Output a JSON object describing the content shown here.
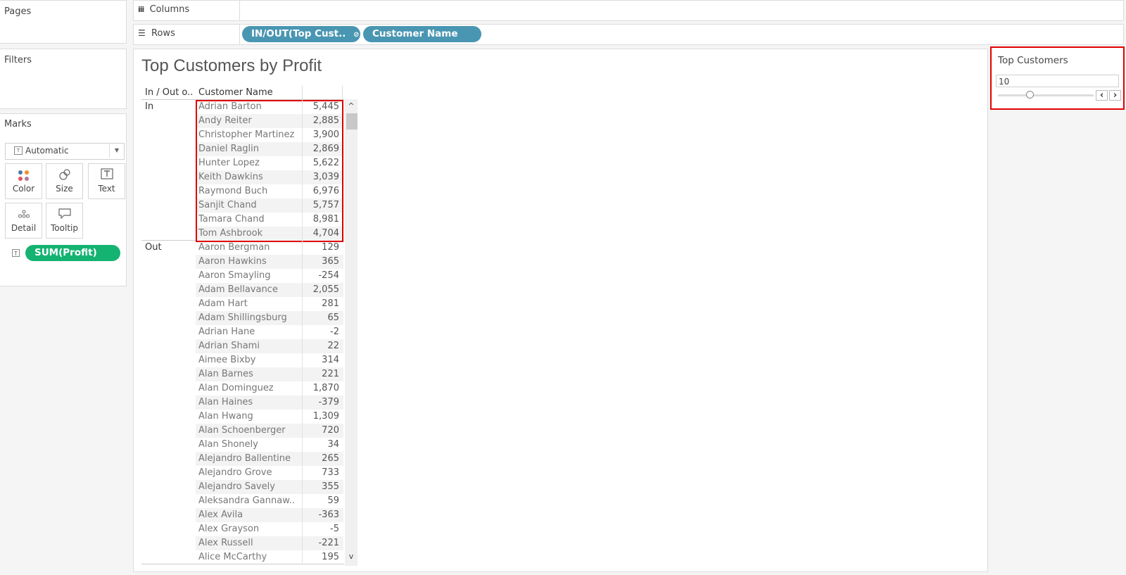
{
  "panes": {
    "pages": "Pages",
    "filters": "Filters",
    "marks": "Marks"
  },
  "marks": {
    "type_selected": "Automatic",
    "buttons": [
      {
        "label": "Color",
        "icon": "color-dots-icon"
      },
      {
        "label": "Size",
        "icon": "size-icon"
      },
      {
        "label": "Text",
        "icon": "text-icon"
      },
      {
        "label": "Detail",
        "icon": "detail-icon"
      },
      {
        "label": "Tooltip",
        "icon": "tooltip-icon"
      }
    ],
    "pill": "SUM(Profit)"
  },
  "shelves": {
    "columns_label": "Columns",
    "rows_label": "Rows",
    "rows_pills": [
      "IN/OUT(Top Cust..",
      "Customer Name"
    ]
  },
  "view": {
    "title": "Top Customers by Profit",
    "col_in_out": "In / Out o..",
    "col_customer": "Customer Name",
    "group_in": "In",
    "group_out": "Out",
    "in_rows": [
      {
        "name": "Adrian Barton",
        "value": "5,445"
      },
      {
        "name": "Andy Reiter",
        "value": "2,885"
      },
      {
        "name": "Christopher Martinez",
        "value": "3,900"
      },
      {
        "name": "Daniel Raglin",
        "value": "2,869"
      },
      {
        "name": "Hunter Lopez",
        "value": "5,622"
      },
      {
        "name": "Keith Dawkins",
        "value": "3,039"
      },
      {
        "name": "Raymond Buch",
        "value": "6,976"
      },
      {
        "name": "Sanjit Chand",
        "value": "5,757"
      },
      {
        "name": "Tamara Chand",
        "value": "8,981"
      },
      {
        "name": "Tom Ashbrook",
        "value": "4,704"
      }
    ],
    "out_rows": [
      {
        "name": "Aaron Bergman",
        "value": "129"
      },
      {
        "name": "Aaron Hawkins",
        "value": "365"
      },
      {
        "name": "Aaron Smayling",
        "value": "-254"
      },
      {
        "name": "Adam Bellavance",
        "value": "2,055"
      },
      {
        "name": "Adam Hart",
        "value": "281"
      },
      {
        "name": "Adam Shillingsburg",
        "value": "65"
      },
      {
        "name": "Adrian Hane",
        "value": "-2"
      },
      {
        "name": "Adrian Shami",
        "value": "22"
      },
      {
        "name": "Aimee Bixby",
        "value": "314"
      },
      {
        "name": "Alan Barnes",
        "value": "221"
      },
      {
        "name": "Alan Dominguez",
        "value": "1,870"
      },
      {
        "name": "Alan Haines",
        "value": "-379"
      },
      {
        "name": "Alan Hwang",
        "value": "1,309"
      },
      {
        "name": "Alan Schoenberger",
        "value": "720"
      },
      {
        "name": "Alan Shonely",
        "value": "34"
      },
      {
        "name": "Alejandro Ballentine",
        "value": "265"
      },
      {
        "name": "Alejandro Grove",
        "value": "733"
      },
      {
        "name": "Alejandro Savely",
        "value": "355"
      },
      {
        "name": "Aleksandra Gannaw..",
        "value": "59"
      },
      {
        "name": "Alex Avila",
        "value": "-363"
      },
      {
        "name": "Alex Grayson",
        "value": "-5"
      },
      {
        "name": "Alex Russell",
        "value": "-221"
      },
      {
        "name": "Alice McCarthy",
        "value": "195"
      }
    ]
  },
  "parameter": {
    "title": "Top Customers",
    "value": "10",
    "slider_fraction": 0.33
  },
  "colors": {
    "pill_dimension": "#4996b2",
    "pill_measure": "#15b371",
    "highlight": "#e00000"
  }
}
